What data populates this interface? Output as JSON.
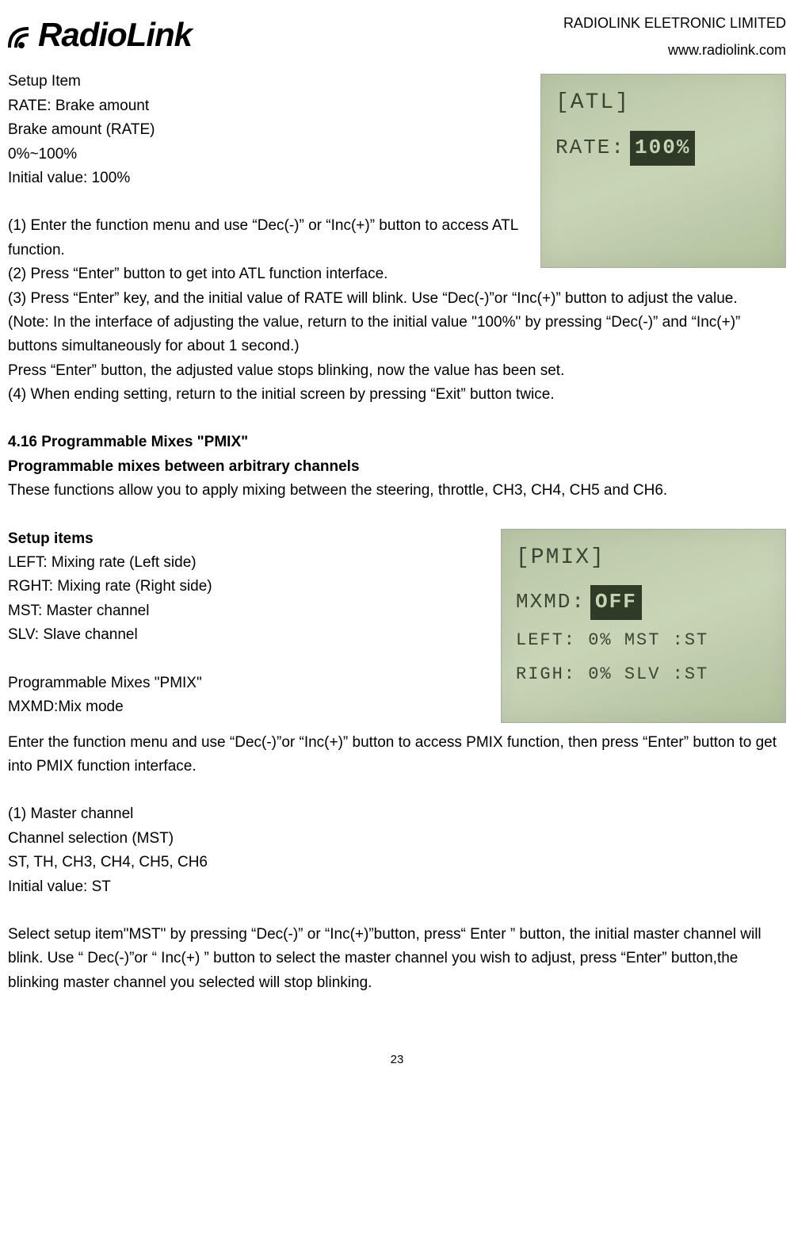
{
  "header": {
    "logo_text": "RadioLink",
    "company": "RADIOLINK ELETRONIC LIMITED",
    "website": "www.radiolink.com"
  },
  "atl": {
    "setup_label": "Setup Item",
    "rate_label": "RATE: Brake amount",
    "brake_label": "Brake amount (RATE)",
    "range": "0%~100%",
    "initial": "Initial value: 100%",
    "step1": "(1) Enter the function menu and use “Dec(-)” or “Inc(+)” button to access ATL function.",
    "step2": "(2) Press  “Enter”  button to get into ATL function interface.",
    "step3": "(3) Press  “Enter”  key, and the initial value of RATE will blink. Use “Dec(-)”or “Inc(+)”  button to adjust the value.",
    "note": "(Note: In the interface of adjusting the value, return to the initial value \"100%\" by pressing  “Dec(-)” and  “Inc(+)”  buttons simultaneously for about 1 second.)",
    "press_enter": "Press  “Enter”  button, the adjusted value stops blinking, now the value has been set.",
    "step4": "(4) When ending setting, return to the initial screen by pressing “Exit”  button twice.",
    "lcd": {
      "title": "[ATL]",
      "rate_prefix": "RATE:",
      "rate_value": "100%"
    }
  },
  "pmix": {
    "title": "4.16 Programmable Mixes \"PMIX\"",
    "subtitle": "Programmable mixes between arbitrary channels",
    "desc": "These functions allow you to apply mixing between the steering, throttle, CH3, CH4, CH5 and CH6.",
    "setup_items_label": "Setup items",
    "left_label": "LEFT: Mixing rate (Left side)",
    "rght_label": "RGHT: Mixing rate (Right side)",
    "mst_label": "MST: Master channel",
    "slv_label": "SLV: Slave channel",
    "mixes_label": "Programmable Mixes \"PMIX\"",
    "mxmd_label": "MXMD:Mix mode",
    "enter_func": "Enter the function menu and use “Dec(-)”or  “Inc(+)”  button to access PMIX function, then press “Enter”  button to get into PMIX function interface.",
    "master_title": "(1) Master channel",
    "channel_sel": "Channel selection (MST)",
    "channels": "ST, TH, CH3, CH4, CH5, CH6",
    "initial": "Initial value: ST",
    "select_mst": "Select setup item\"MST\" by pressing  “Dec(-)”  or “Inc(+)”button, press“ Enter ”  button, the initial master channel will blink. Use “ Dec(-)”or “ Inc(+) ”  button to select the master channel you wish to adjust, press “Enter”  button,the blinking master channel you selected will stop blinking.",
    "lcd": {
      "title": "[PMIX]",
      "mxmd_prefix": "MXMD:",
      "mxmd_value": "OFF",
      "left_row": "LEFT:   0% MST :ST",
      "righ_row": "RIGH:   0% SLV :ST"
    }
  },
  "page_number": "23"
}
